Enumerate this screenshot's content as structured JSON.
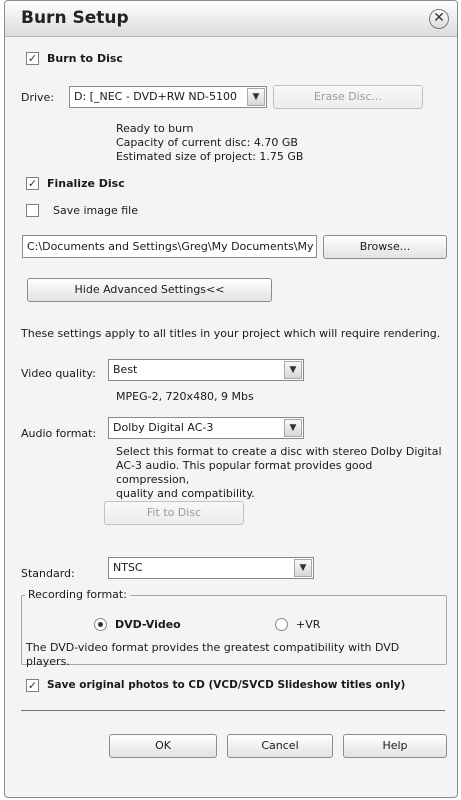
{
  "dialog": {
    "title": "Burn Setup",
    "close_glyph": "✕"
  },
  "burn": {
    "burn_to_disc_label": "Burn to Disc",
    "burn_to_disc_checked": true,
    "drive_label": "Drive:",
    "drive_value": "D: [_NEC    - DVD+RW ND-5100",
    "erase_disc_label": "Erase Disc...",
    "status_line1": "Ready to burn",
    "status_line2": "Capacity of current disc: 4.70 GB",
    "status_line3": "Estimated size of project: 1.75 GB",
    "finalize_label": "Finalize Disc",
    "finalize_checked": true,
    "save_image_label": "Save image file",
    "save_image_checked": false,
    "image_path": "C:\\Documents and Settings\\Greg\\My Documents\\My '",
    "browse_label": "Browse...",
    "advanced_button_label": "Hide Advanced Settings<<"
  },
  "advanced": {
    "intro": "These settings apply to all titles in your project which will require rendering.",
    "video_quality_label": "Video quality:",
    "video_quality_value": "Best",
    "video_quality_info": "MPEG-2, 720x480, 9 Mbs",
    "audio_format_label": "Audio format:",
    "audio_format_value": "Dolby Digital AC-3",
    "audio_desc_line1": "Select this format to create a disc with stereo Dolby Digital",
    "audio_desc_line2": "AC-3 audio. This popular format provides good compression,",
    "audio_desc_line3": "quality and compatibility.",
    "fit_to_disc_label": "Fit to Disc",
    "standard_label": "Standard:",
    "standard_value": "NTSC",
    "recording_format_label": "Recording format:",
    "dvd_video_label": "DVD-Video",
    "dvd_video_selected": true,
    "vr_label": "+VR",
    "vr_selected": false,
    "format_desc_line1": "The DVD-video format provides the greatest compatibility with DVD",
    "format_desc_line2": "players.",
    "save_photos_label": "Save original photos to CD (VCD/SVCD Slideshow titles only)",
    "save_photos_checked": true
  },
  "footer": {
    "ok_label": "OK",
    "cancel_label": "Cancel",
    "help_label": "Help"
  },
  "icons": {
    "check_glyph": "✓",
    "dropdown_glyph": "▼"
  }
}
